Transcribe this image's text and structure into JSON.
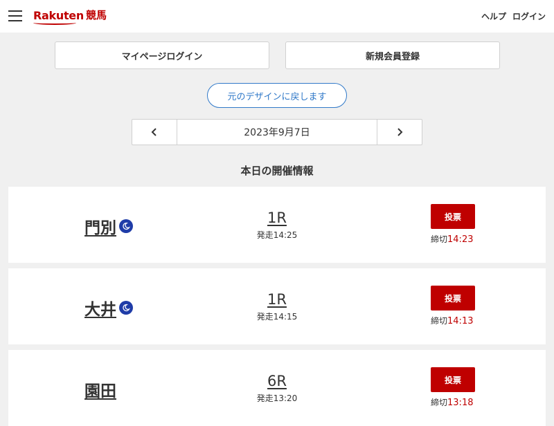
{
  "header": {
    "logo_brand": "Rakuten",
    "logo_service": "競馬",
    "links": [
      "ヘルプ",
      "ログイン"
    ]
  },
  "buttons": {
    "mypage_login": "マイページログイン",
    "register": "新規会員登録",
    "design_restore": "元のデザインに戻します"
  },
  "date_nav": {
    "date": "2023年9月7日"
  },
  "section_title": "本日の開催情報",
  "vote_label": "投票",
  "deadline_prefix": "締切",
  "races": [
    {
      "venue": "門別",
      "night": true,
      "race": "1R",
      "start": "発走14:25",
      "deadline": "14:23"
    },
    {
      "venue": "大井",
      "night": true,
      "race": "1R",
      "start": "発走14:15",
      "deadline": "14:13"
    },
    {
      "venue": "園田",
      "night": false,
      "race": "6R",
      "start": "発走13:20",
      "deadline": "13:18"
    }
  ],
  "colors": {
    "brand_red": "#bf0000",
    "link_blue": "#2f78c8",
    "night_icon": "#1f3ca8",
    "background": "#f0f0f0"
  }
}
